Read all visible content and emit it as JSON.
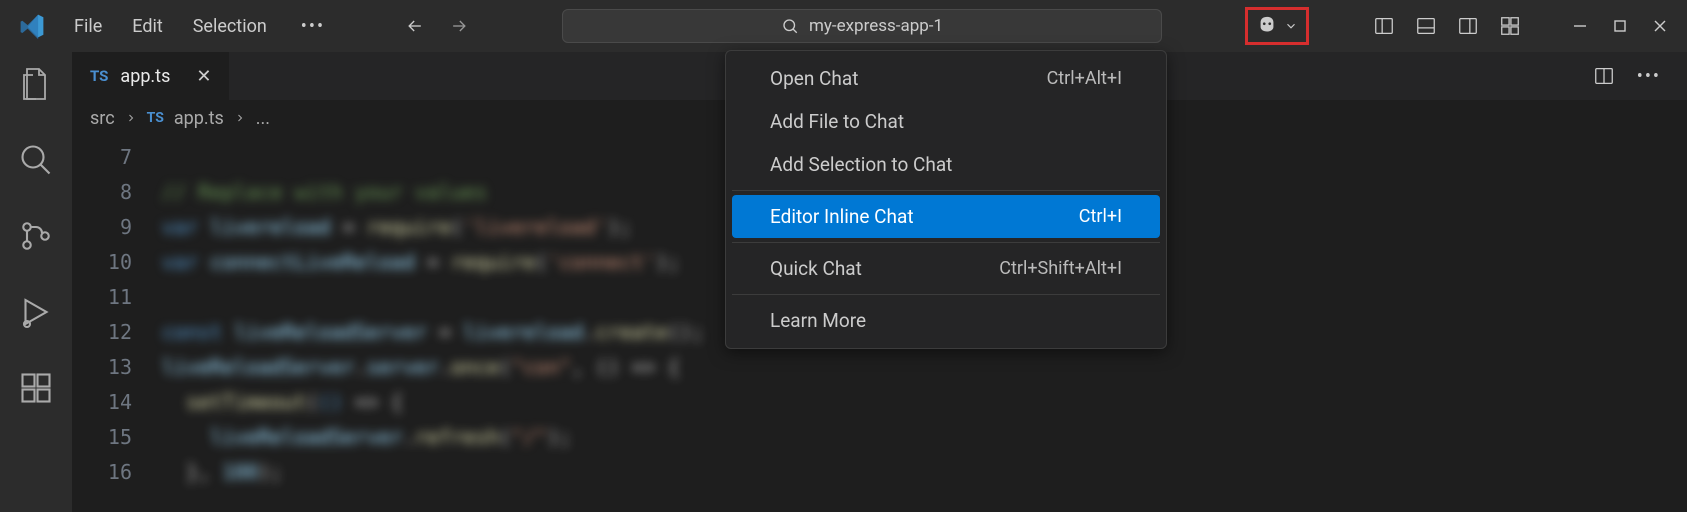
{
  "menubar": {
    "file": "File",
    "edit": "Edit",
    "selection": "Selection"
  },
  "search": {
    "text": "my-express-app-1"
  },
  "tab": {
    "badge": "TS",
    "filename": "app.ts"
  },
  "breadcrumb": {
    "src": "src",
    "badge": "TS",
    "file": "app.ts",
    "trail": "..."
  },
  "lines": [
    "7",
    "8",
    "9",
    "10",
    "11",
    "12",
    "13",
    "14",
    "15",
    "16"
  ],
  "copilotMenu": {
    "openChat": {
      "label": "Open Chat",
      "shortcut": "Ctrl+Alt+I"
    },
    "addFile": {
      "label": "Add File to Chat"
    },
    "addSelection": {
      "label": "Add Selection to Chat"
    },
    "inlineChat": {
      "label": "Editor Inline Chat",
      "shortcut": "Ctrl+I"
    },
    "quickChat": {
      "label": "Quick Chat",
      "shortcut": "Ctrl+Shift+Alt+I"
    },
    "learnMore": {
      "label": "Learn More"
    }
  }
}
